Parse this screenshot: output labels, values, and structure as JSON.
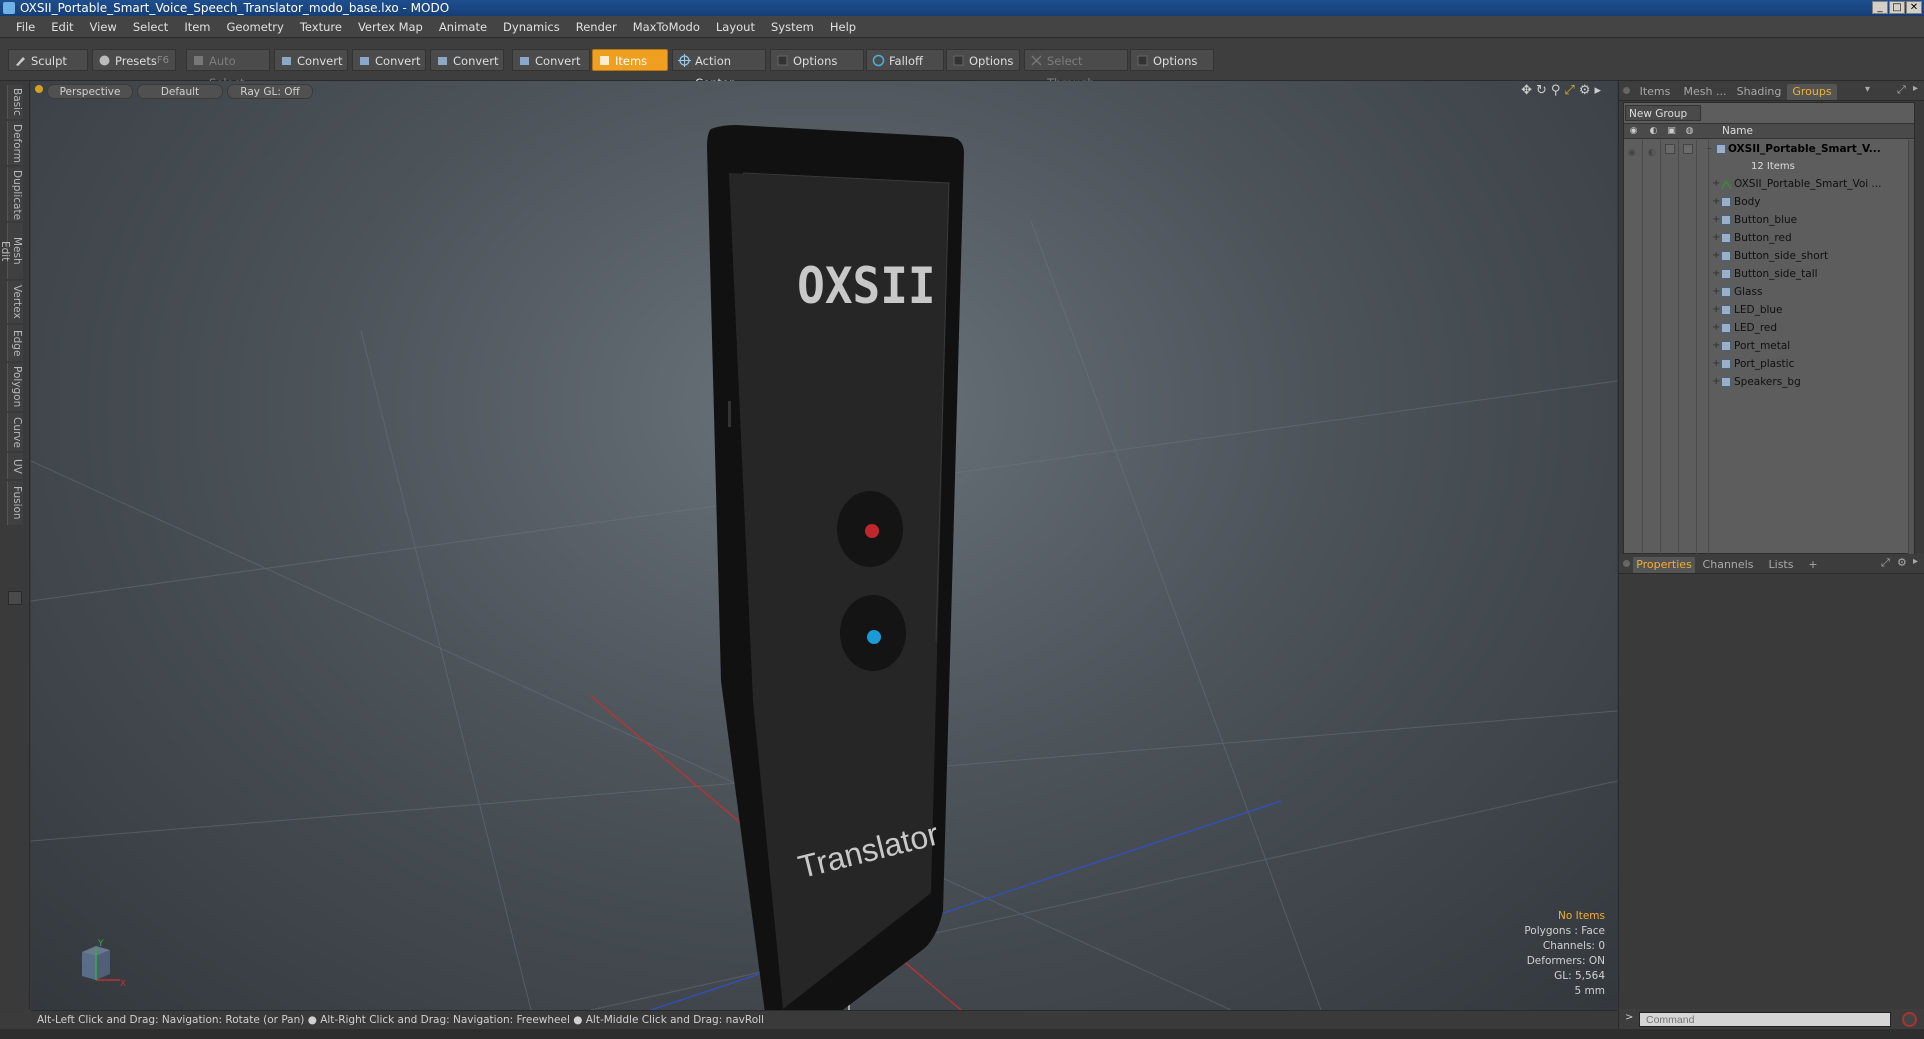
{
  "window": {
    "title": "OXSII_Portable_Smart_Voice_Speech_Translator_modo_base.lxo - MODO",
    "controls": [
      "_",
      "□",
      "✕"
    ]
  },
  "menu": [
    "File",
    "Edit",
    "View",
    "Select",
    "Item",
    "Geometry",
    "Texture",
    "Vertex Map",
    "Animate",
    "Dynamics",
    "Render",
    "MaxToModo",
    "Layout",
    "System",
    "Help"
  ],
  "toolbar": {
    "sculpt": "Sculpt",
    "presets": "Presets",
    "presets_shortcut": "F6",
    "auto_select": "Auto Select",
    "convert1": "Convert",
    "convert2": "Convert",
    "convert3": "Convert",
    "convert4": "Convert",
    "items": "Items",
    "action_center": "Action Center",
    "options1": "Options",
    "falloff": "Falloff",
    "options2": "Options",
    "select_through": "Select Through",
    "options3": "Options"
  },
  "left_tabs": [
    "Basic",
    "Deform",
    "Duplicate",
    "Mesh Edit",
    "Vertex",
    "Edge",
    "Polygon",
    "Curve",
    "UV",
    "Fusion"
  ],
  "viewport": {
    "view_mode": "Perspective",
    "shading": "Default",
    "raygl": "Ray GL: Off",
    "model_brand": "OXSII",
    "model_label": "Translator",
    "led_top_color": "#c0272d",
    "led_bottom_color": "#1a9bd7",
    "stats": {
      "selection": "No Items",
      "polygons": "Polygons : Face",
      "channels": "Channels: 0",
      "deformers": "Deformers: ON",
      "gl": "GL: 5,564",
      "scale": "5 mm"
    },
    "gizmo_x": "X",
    "gizmo_y": "Y"
  },
  "status_hint": "Alt-Left Click and Drag: Navigation: Rotate (or Pan) ● Alt-Right Click and Drag: Navigation: Freewheel ● Alt-Middle Click and Drag: navRoll",
  "right_panel": {
    "top_tabs": [
      "Items",
      "Mesh ...",
      "Shading",
      "Groups"
    ],
    "active_top_tab": "Groups",
    "new_group": "New Group",
    "name_column": "Name",
    "root": {
      "label": "OXSII_Portable_Smart_V...",
      "count": "12 Items"
    },
    "children": [
      "OXSII_Portable_Smart_Voi ...",
      "Body",
      "Button_blue",
      "Button_red",
      "Button_side_short",
      "Button_side_tall",
      "Glass",
      "LED_blue",
      "LED_red",
      "Port_metal",
      "Port_plastic",
      "Speakers_bg"
    ],
    "bottom_tabs": [
      "Properties",
      "Channels",
      "Lists",
      "+"
    ],
    "active_bottom_tab": "Properties",
    "command_placeholder": "Command"
  },
  "colors": {
    "accent": "#f0a020",
    "title_bar": "#1e4f8f"
  }
}
